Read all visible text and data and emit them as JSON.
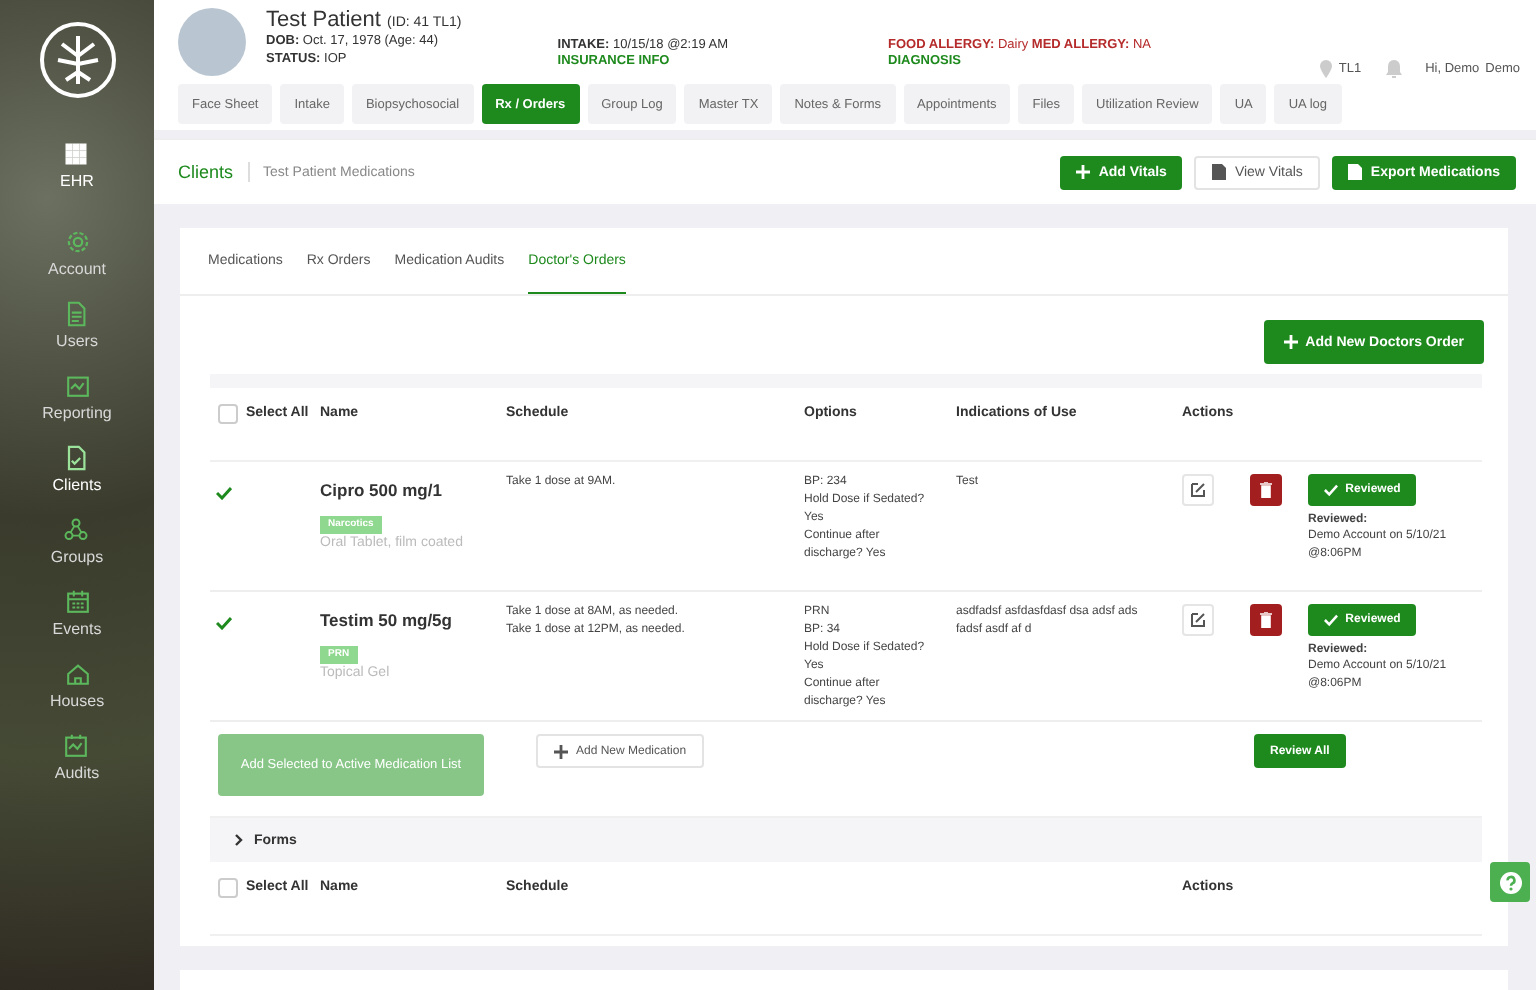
{
  "sidebar": {
    "items": [
      {
        "label": "EHR",
        "selected": false
      },
      {
        "label": "Account",
        "selected": false
      },
      {
        "label": "Users",
        "selected": false
      },
      {
        "label": "Reporting",
        "selected": false
      },
      {
        "label": "Clients",
        "selected": true
      },
      {
        "label": "Groups",
        "selected": false
      },
      {
        "label": "Events",
        "selected": false
      },
      {
        "label": "Houses",
        "selected": false
      },
      {
        "label": "Audits",
        "selected": false
      }
    ]
  },
  "patient": {
    "name": "Test Patient",
    "id": "(ID: 41 TL1)",
    "dob_label": "DOB:",
    "dob": "Oct. 17, 1978 (Age: 44)",
    "status_label": "STATUS:",
    "status": "IOP",
    "intake_label": "INTAKE:",
    "intake": "10/15/18 @2:19 AM",
    "insurance": "INSURANCE INFO",
    "food_allergy_label": "FOOD ALLERGY:",
    "food_allergy": "Dairy",
    "med_allergy_label": "MED ALLERGY:",
    "med_allergy": "NA",
    "diagnosis": "DIAGNOSIS"
  },
  "user_bar": {
    "location": "TL1",
    "greeting": "Hi, Demo",
    "avatar_alt": "Demo"
  },
  "tabs": [
    {
      "label": "Face Sheet",
      "selected": false
    },
    {
      "label": "Intake",
      "selected": false
    },
    {
      "label": "Biopsychosocial",
      "selected": false
    },
    {
      "label": "Rx / Orders",
      "selected": true
    },
    {
      "label": "Group Log",
      "selected": false
    },
    {
      "label": "Master TX",
      "selected": false
    },
    {
      "label": "Notes & Forms",
      "selected": false
    },
    {
      "label": "Appointments",
      "selected": false
    },
    {
      "label": "Files",
      "selected": false
    },
    {
      "label": "Utilization Review",
      "selected": false
    },
    {
      "label": "UA",
      "selected": false
    },
    {
      "label": "UA log",
      "selected": false
    }
  ],
  "breadcrumb": [
    "Clients",
    "Test Patient Medications"
  ],
  "toolbar": {
    "add_vitals": "Add Vitals",
    "view_vitals": "View Vitals",
    "export": "Export Medications"
  },
  "subtabs": [
    {
      "label": "Medications",
      "selected": false
    },
    {
      "label": "Rx Orders",
      "selected": false
    },
    {
      "label": "Medication Audits",
      "selected": false
    },
    {
      "label": "Doctor's Orders",
      "selected": true
    }
  ],
  "add_order_button": "Add New Doctors Order",
  "medications": {
    "select_all_checked": false,
    "columns": [
      "Select All",
      "Name",
      "Schedule",
      "Options",
      "Indications of Use",
      "Actions"
    ],
    "rows": [
      {
        "checked": true,
        "name": "Cipro 500 mg/1",
        "badge": "Narcotics",
        "form": "Oral Tablet, film coated",
        "schedule": [
          "Take 1 dose at 9AM."
        ],
        "options": [
          "BP: 234",
          "Hold Dose if Sedated?",
          "Yes",
          "Continue after",
          "discharge? Yes"
        ],
        "indications": "Test",
        "review_button": "Reviewed",
        "reviewed_label": "Reviewed:",
        "reviewed_by": "Demo Account on 5/10/21 @8:06PM"
      },
      {
        "checked": true,
        "name": "Testim 50 mg/5g",
        "badge": "PRN",
        "form": "Topical Gel",
        "schedule": [
          "Take 1 dose at 8AM, as needed.",
          "Take 1 dose at 12PM, as needed."
        ],
        "options": [
          "PRN",
          "BP: 34",
          "Hold Dose if Sedated?",
          "Yes",
          "Continue after",
          "discharge? Yes"
        ],
        "indications": "asdfadsf asfdasfdasf dsa adsf ads fadsf asdf af d",
        "review_button": "Reviewed",
        "reviewed_label": "Reviewed:",
        "reviewed_by": "Demo Account on 5/10/21 @8:06PM"
      }
    ],
    "add_selected": {
      "label": "Add Selected to Active Medication List",
      "disabled": true
    },
    "add_new": "Add New Medication",
    "review_all": "Review All"
  },
  "forms": {
    "title": "Forms",
    "expanded": false,
    "select_all_checked": false,
    "columns": [
      "Select All",
      "Name",
      "Schedule",
      "Actions"
    ]
  }
}
